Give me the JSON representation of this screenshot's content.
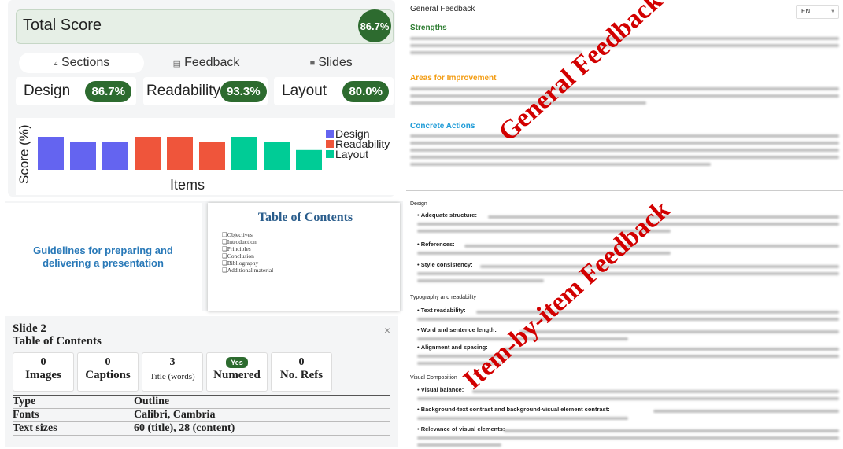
{
  "total": {
    "label": "Total Score",
    "value": "86.7%"
  },
  "tabs": [
    {
      "icon": "⟀",
      "label": "Sections"
    },
    {
      "icon": "▤",
      "label": "Feedback"
    },
    {
      "icon": "■",
      "label": "Slides"
    }
  ],
  "metrics": {
    "design": {
      "label": "Design",
      "value": "86.7%"
    },
    "readability": {
      "label": "Readability",
      "value": "93.3%"
    },
    "layout": {
      "label": "Layout",
      "value": "80.0%"
    }
  },
  "chart_data": {
    "type": "bar",
    "title": "",
    "xlabel": "Items",
    "ylabel": "Score (%)",
    "legend_position": "right",
    "series": [
      {
        "name": "Design",
        "color": "#6464f0",
        "values": [
          100,
          85,
          85
        ]
      },
      {
        "name": "Readability",
        "color": "#ef553b",
        "values": [
          100,
          100,
          85
        ]
      },
      {
        "name": "Layout",
        "color": "#00cc96",
        "values": [
          100,
          85,
          60
        ]
      }
    ],
    "ylim": [
      0,
      100
    ]
  },
  "slides": {
    "slide1_title": "Guidelines for preparing and delivering a presentation",
    "slide2_title": "Table of Contents",
    "slide2_items": [
      "Objectives",
      "Introduction",
      "Principles",
      "Conclusion",
      "Bibliography",
      "Additional material"
    ]
  },
  "detail": {
    "slide_no": "Slide 2",
    "slide_name": "Table of Contents",
    "close": "×",
    "stats": [
      {
        "value": "0",
        "key": "Images"
      },
      {
        "value": "0",
        "key": "Captions"
      },
      {
        "value": "3",
        "key": "Title (words)"
      },
      {
        "value": "Yes",
        "key": "Numered"
      },
      {
        "value": "0",
        "key": "No. Refs"
      }
    ],
    "props": [
      {
        "k": "Type",
        "v": "Outline"
      },
      {
        "k": "Fonts",
        "v": "Calibri, Cambria"
      },
      {
        "k": "Text sizes",
        "v": "60 (title), 28 (content)"
      }
    ]
  },
  "feedback": {
    "header": "General Feedback",
    "lang": "EN",
    "strengths": "Strengths",
    "improvement": "Areas for Improvement",
    "actions": "Concrete Actions",
    "colors": {
      "strengths": "#2e7d32",
      "improvement": "#f39c12",
      "actions": "#1e9bd7"
    },
    "design_head": "Design",
    "design_items": [
      "Adequate structure:",
      "References:",
      "Style consistency:"
    ],
    "typo_head": "Typography and readability",
    "typo_items": [
      "Text readability:",
      "Word and sentence length:",
      "Alignment and spacing:"
    ],
    "visual_head": "Visual Composition",
    "visual_items": [
      "Visual balance:",
      "Background-text contrast and background-visual element contrast:",
      "Relevance of visual elements:"
    ]
  },
  "watermarks": {
    "general": "General Feedback",
    "item": "Item-by-item Feedback"
  }
}
